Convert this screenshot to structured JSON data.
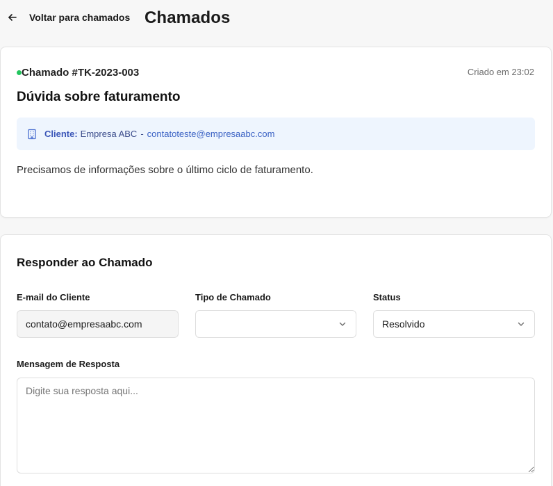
{
  "header": {
    "back_label": "Voltar para chamados",
    "title": "Chamados"
  },
  "ticket": {
    "id": "Chamado #TK-2023-003",
    "status_color": "#22c55e",
    "created": "Criado em 23:02",
    "subject": "Dúvida sobre faturamento",
    "client_label": "Cliente:",
    "client_name": "Empresa ABC",
    "separator": "-",
    "client_email": "contatoteste@empresaabc.com",
    "description": "Precisamos de informações sobre o último ciclo de faturamento."
  },
  "reply": {
    "title": "Responder ao Chamado",
    "email_label": "E-mail do Cliente",
    "email_value": "contato@empresaabc.com",
    "type_label": "Tipo de Chamado",
    "type_value": "",
    "status_label": "Status",
    "status_value": "Resolvido",
    "message_label": "Mensagem de Resposta",
    "message_placeholder": "Digite sua resposta aqui..."
  },
  "colors": {
    "accent": "#3b56b8",
    "client_bg": "#eef5fe",
    "status_dot": "#22c55e"
  }
}
